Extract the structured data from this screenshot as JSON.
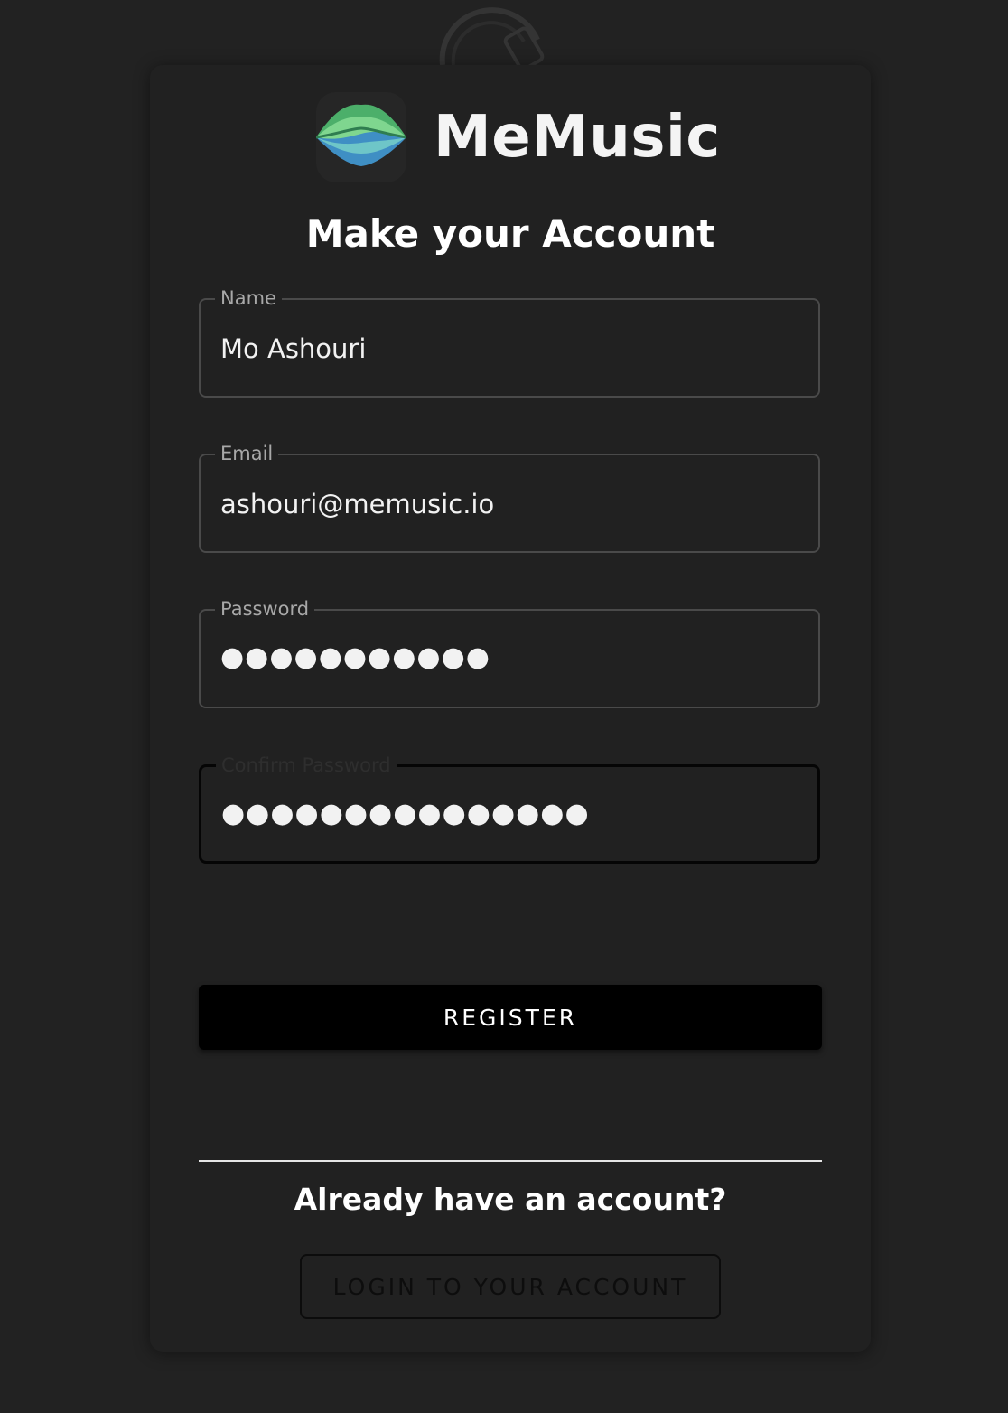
{
  "brand": {
    "name": "MeMusic",
    "logo_icon": "waveform-icon",
    "colors": {
      "wave_green": "#5cc97a",
      "wave_blue": "#4a9fd1",
      "wave_dark_green": "#2e7d4f"
    }
  },
  "background": {
    "icon": "headphones-icon"
  },
  "form": {
    "heading": "Make your Account",
    "fields": {
      "name": {
        "label": "Name",
        "value": "Mo Ashouri"
      },
      "email": {
        "label": "Email",
        "value": "ashouri@memusic.io"
      },
      "password": {
        "label": "Password",
        "value": "●●●●●●●●●●●"
      },
      "confirm_password": {
        "label": "Confirm Password",
        "value": "●●●●●●●●●●●●●●●"
      }
    },
    "register_label": "REGISTER"
  },
  "login": {
    "prompt": "Already have an account?",
    "button_label": "LOGIN TO YOUR ACCOUNT"
  },
  "theme": {
    "background": "#222222",
    "card": "#212121",
    "button_primary": "#000000"
  }
}
